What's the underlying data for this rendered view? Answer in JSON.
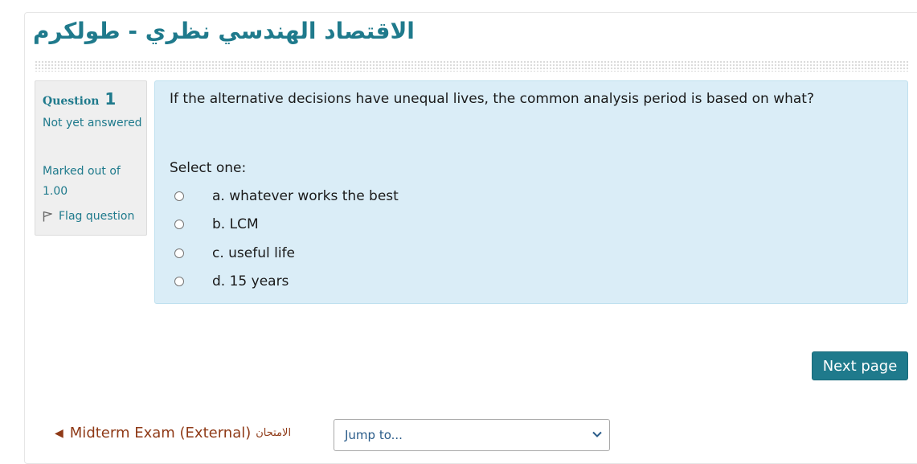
{
  "quiz_title": "الاقتصاد الهندسي نظري - طولكرم",
  "question_info": {
    "label": "Question",
    "number": "1",
    "state": "Not yet answered",
    "grade": "Marked out of 1.00",
    "flag_label": "Flag question"
  },
  "question": {
    "text": "If the alternative decisions have unequal lives, the common analysis period is based on what?",
    "prompt": "Select one:",
    "options": [
      {
        "label": "a. whatever works the best",
        "selected": false
      },
      {
        "label": "b. LCM",
        "selected": false
      },
      {
        "label": "c. useful life",
        "selected": false
      },
      {
        "label": "d. 15 years",
        "selected": false
      }
    ]
  },
  "navigation": {
    "next_label": "Next page",
    "prev_link": "Midterm Exam (External)",
    "prev_link_arabic": "الامتحان",
    "jump_placeholder": "Jump to..."
  },
  "colors": {
    "accent": "#1f7a8c",
    "content_bg": "#daedf7",
    "link_prev": "#8f3a17"
  },
  "icons": {
    "flag": "flag-icon",
    "prev": "left-triangle-icon",
    "dropdown": "chevron-down-icon"
  }
}
